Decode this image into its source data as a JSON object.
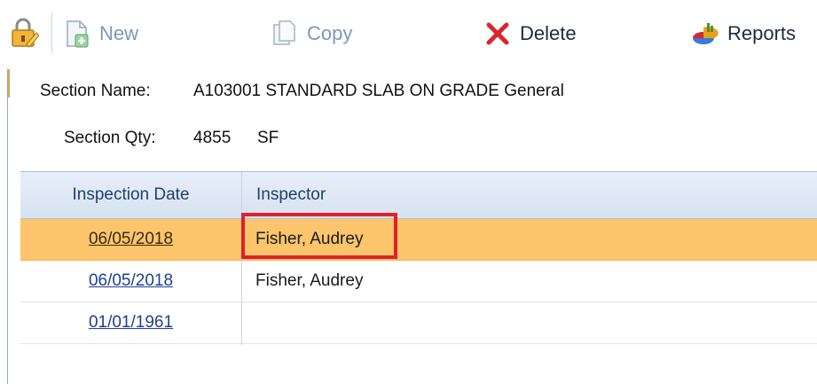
{
  "toolbar": {
    "new_label": "New",
    "copy_label": "Copy",
    "delete_label": "Delete",
    "reports_label": "Reports"
  },
  "section": {
    "name_label": "Section Name:",
    "name_value": "A103001 STANDARD SLAB ON GRADE General",
    "qty_label": "Section Qty:",
    "qty_value": "4855",
    "qty_unit": "SF"
  },
  "grid": {
    "headers": [
      "Inspection Date",
      "Inspector"
    ],
    "rows": [
      {
        "date": "06/05/2018",
        "inspector": "Fisher, Audrey",
        "selected": true
      },
      {
        "date": "06/05/2018",
        "inspector": "Fisher, Audrey",
        "selected": false
      },
      {
        "date": "01/01/1961",
        "inspector": "",
        "selected": false
      }
    ]
  },
  "colors": {
    "selected_row": "#fcc56b",
    "highlight": "#e0202a",
    "link": "#1f3f8f",
    "header_text": "#20406e"
  }
}
